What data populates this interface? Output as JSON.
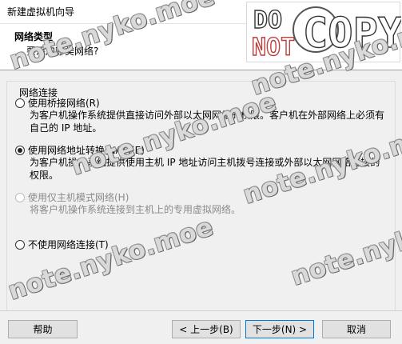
{
  "window": {
    "title": "新建虚拟机向导"
  },
  "header": {
    "title": "网络类型",
    "subtitle": "要添加哪类网络?"
  },
  "logo": {
    "line1": "DO",
    "line2": "NOT",
    "line3": "COPY"
  },
  "group": {
    "label": "网络连接"
  },
  "options": [
    {
      "label": "使用桥接网络(R)",
      "desc": "为客户机操作系统提供直接访问外部以太网网络的权限。客户机在外部网络上必须有自己的 IP 地址。",
      "checked": false,
      "enabled": true
    },
    {
      "label": "使用网络地址转换(NAT)(E)",
      "desc": "为客户机操作系统提供使用主机 IP 地址访问主机拨号连接或外部以太网网络连接的权限。",
      "checked": true,
      "enabled": true
    },
    {
      "label": "使用仅主机模式网络(H)",
      "desc": "将客户机操作系统连接到主机上的专用虚拟网络。",
      "checked": false,
      "enabled": false
    },
    {
      "label": "不使用网络连接(T)",
      "desc": "",
      "checked": false,
      "enabled": true
    }
  ],
  "buttons": {
    "help": "帮助",
    "back": "< 上一步(B)",
    "next": "下一步(N) >",
    "cancel": "取消"
  },
  "watermark": {
    "text": "note.nyko.moe"
  }
}
